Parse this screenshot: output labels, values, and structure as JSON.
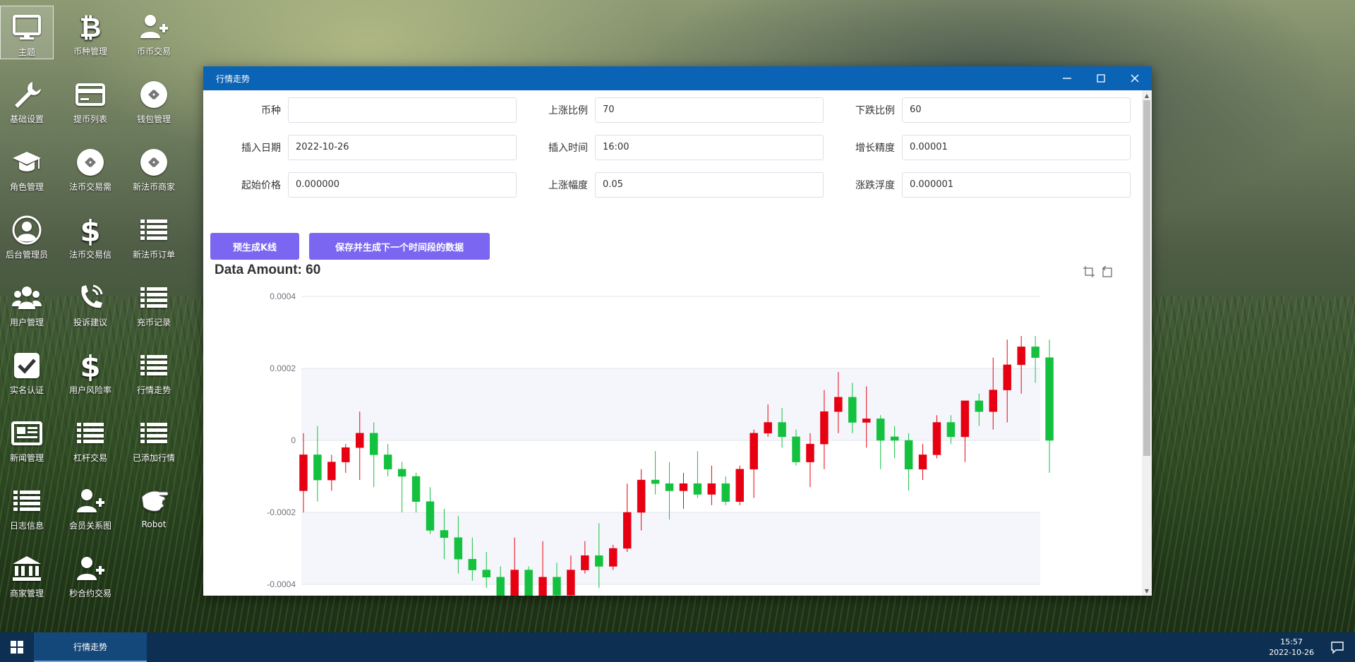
{
  "desktop": {
    "icons": [
      {
        "label": "主题",
        "icon": "monitor-icon"
      },
      {
        "label": "币种管理",
        "icon": "bitcoin-icon"
      },
      {
        "label": "币币交易",
        "icon": "user-plus-icon"
      },
      {
        "label": "基础设置",
        "icon": "wrench-icon"
      },
      {
        "label": "提币列表",
        "icon": "credit-card-icon"
      },
      {
        "label": "钱包管理",
        "icon": "exchange-icon"
      },
      {
        "label": "角色管理",
        "icon": "graduation-cap-icon"
      },
      {
        "label": "法币交易需",
        "icon": "exchange-icon"
      },
      {
        "label": "新法币商家",
        "icon": "exchange-icon"
      },
      {
        "label": "后台管理员",
        "icon": "user-circle-icon"
      },
      {
        "label": "法币交易信",
        "icon": "dollar-icon"
      },
      {
        "label": "新法币订单",
        "icon": "list-icon"
      },
      {
        "label": "用户管理",
        "icon": "users-icon"
      },
      {
        "label": "投诉建议",
        "icon": "phone-icon"
      },
      {
        "label": "充币记录",
        "icon": "list-icon"
      },
      {
        "label": "实名认证",
        "icon": "check-square-icon"
      },
      {
        "label": "用户风险率",
        "icon": "dollar-icon"
      },
      {
        "label": "行情走势",
        "icon": "list-icon"
      },
      {
        "label": "新闻管理",
        "icon": "newspaper-icon"
      },
      {
        "label": "杠杆交易",
        "icon": "list-icon"
      },
      {
        "label": "已添加行情",
        "icon": "list-icon"
      },
      {
        "label": "日志信息",
        "icon": "list-icon"
      },
      {
        "label": "会员关系图",
        "icon": "user-plus-icon"
      },
      {
        "label": "Robot",
        "icon": "hand-icon"
      },
      {
        "label": "商家管理",
        "icon": "bank-icon"
      },
      {
        "label": "秒合约交易",
        "icon": "user-plus-icon"
      }
    ]
  },
  "window": {
    "title": "行情走势",
    "form": {
      "coin": {
        "label": "币种",
        "value": ""
      },
      "rise_ratio": {
        "label": "上涨比例",
        "value": "70"
      },
      "fall_ratio": {
        "label": "下跌比例",
        "value": "60"
      },
      "insert_date": {
        "label": "插入日期",
        "value": "2022-10-26"
      },
      "insert_time": {
        "label": "插入时间",
        "value": "16:00"
      },
      "growth_precision": {
        "label": "增长精度",
        "value": "0.00001"
      },
      "start_price": {
        "label": "起始价格",
        "value": "0.000000"
      },
      "rise_range": {
        "label": "上涨幅度",
        "value": "0.05"
      },
      "fluctuation": {
        "label": "涨跌浮度",
        "value": "0.000001"
      }
    },
    "buttons": {
      "pregenerate": "预生成K线",
      "save_next": "保存并生成下一个时间段的数据"
    },
    "data_amount": "Data Amount: 60"
  },
  "colors": {
    "up": "#e60012",
    "down": "#14c13f",
    "accent": "#7b66f2",
    "titlebar": "#0b63b6",
    "taskbar": "#0c2f52"
  },
  "chart_data": {
    "type": "candlestick",
    "y_tick_labels": [
      "0.0004",
      "0.0002",
      "0",
      "-0.0002",
      "-0.0004"
    ],
    "y_ticks": [
      0.0004,
      0.0002,
      0,
      -0.0002,
      -0.0004
    ],
    "ylim": [
      -0.00048,
      0.0004
    ],
    "grid": true,
    "candles": [
      {
        "o": -0.00014,
        "c": -4e-05,
        "h": 2e-05,
        "l": -0.0002
      },
      {
        "o": -4e-05,
        "c": -0.00011,
        "h": 4e-05,
        "l": -0.00017
      },
      {
        "o": -0.00011,
        "c": -6e-05,
        "h": -4e-05,
        "l": -0.00014
      },
      {
        "o": -6e-05,
        "c": -2e-05,
        "h": -1e-05,
        "l": -9e-05
      },
      {
        "o": -2e-05,
        "c": 2e-05,
        "h": 8e-05,
        "l": -0.00011
      },
      {
        "o": 2e-05,
        "c": -4e-05,
        "h": 5e-05,
        "l": -0.00013
      },
      {
        "o": -4e-05,
        "c": -8e-05,
        "h": -1e-05,
        "l": -0.0001
      },
      {
        "o": -8e-05,
        "c": -0.0001,
        "h": -6e-05,
        "l": -0.0002
      },
      {
        "o": -0.0001,
        "c": -0.00017,
        "h": -9e-05,
        "l": -0.0002
      },
      {
        "o": -0.00017,
        "c": -0.00025,
        "h": -0.00013,
        "l": -0.00026
      },
      {
        "o": -0.00025,
        "c": -0.00027,
        "h": -0.00019,
        "l": -0.00033
      },
      {
        "o": -0.00027,
        "c": -0.00033,
        "h": -0.00021,
        "l": -0.00037
      },
      {
        "o": -0.00033,
        "c": -0.00036,
        "h": -0.00027,
        "l": -0.00039
      },
      {
        "o": -0.00036,
        "c": -0.00038,
        "h": -0.00031,
        "l": -0.00041
      },
      {
        "o": -0.00038,
        "c": -0.00046,
        "h": -0.00035,
        "l": -0.00048
      },
      {
        "o": -0.00046,
        "c": -0.00036,
        "h": -0.00027,
        "l": -0.00048
      },
      {
        "o": -0.00036,
        "c": -0.00044,
        "h": -0.00035,
        "l": -0.00048
      },
      {
        "o": -0.00044,
        "c": -0.00038,
        "h": -0.00028,
        "l": -0.00047
      },
      {
        "o": -0.00038,
        "c": -0.00043,
        "h": -0.00034,
        "l": -0.00045
      },
      {
        "o": -0.00043,
        "c": -0.00036,
        "h": -0.00032,
        "l": -0.00044
      },
      {
        "o": -0.00036,
        "c": -0.00032,
        "h": -0.00028,
        "l": -0.00037
      },
      {
        "o": -0.00032,
        "c": -0.00035,
        "h": -0.00023,
        "l": -0.00041
      },
      {
        "o": -0.00035,
        "c": -0.0003,
        "h": -0.00029,
        "l": -0.00036
      },
      {
        "o": -0.0003,
        "c": -0.0002,
        "h": -0.00012,
        "l": -0.00031
      },
      {
        "o": -0.0002,
        "c": -0.00011,
        "h": -8e-05,
        "l": -0.00025
      },
      {
        "o": -0.00011,
        "c": -0.00012,
        "h": -3e-05,
        "l": -0.00015
      },
      {
        "o": -0.00012,
        "c": -0.00014,
        "h": -6e-05,
        "l": -0.00022
      },
      {
        "o": -0.00014,
        "c": -0.00012,
        "h": -9e-05,
        "l": -0.00019
      },
      {
        "o": -0.00012,
        "c": -0.00015,
        "h": -3e-05,
        "l": -0.00016
      },
      {
        "o": -0.00015,
        "c": -0.00012,
        "h": -7e-05,
        "l": -0.00018
      },
      {
        "o": -0.00012,
        "c": -0.00017,
        "h": -0.0001,
        "l": -0.00018
      },
      {
        "o": -0.00017,
        "c": -8e-05,
        "h": -7e-05,
        "l": -0.00018
      },
      {
        "o": -8e-05,
        "c": 2e-05,
        "h": 3e-05,
        "l": -0.00016
      },
      {
        "o": 2e-05,
        "c": 5e-05,
        "h": 0.0001,
        "l": 1e-05
      },
      {
        "o": 5e-05,
        "c": 1e-05,
        "h": 9e-05,
        "l": -2e-05
      },
      {
        "o": 1e-05,
        "c": -6e-05,
        "h": 3e-05,
        "l": -7e-05
      },
      {
        "o": -6e-05,
        "c": -1e-05,
        "h": 2e-05,
        "l": -0.00013
      },
      {
        "o": -1e-05,
        "c": 8e-05,
        "h": 0.00014,
        "l": -8e-05
      },
      {
        "o": 8e-05,
        "c": 0.00012,
        "h": 0.00019,
        "l": 2e-05
      },
      {
        "o": 0.00012,
        "c": 5e-05,
        "h": 0.00016,
        "l": 2e-05
      },
      {
        "o": 5e-05,
        "c": 6e-05,
        "h": 0.00015,
        "l": -2e-05
      },
      {
        "o": 6e-05,
        "c": 0,
        "h": 7e-05,
        "l": -8e-05
      },
      {
        "o": 1e-05,
        "c": 0,
        "h": 4e-05,
        "l": -5e-05
      },
      {
        "o": 0,
        "c": -8e-05,
        "h": 2e-05,
        "l": -0.00014
      },
      {
        "o": -8e-05,
        "c": -4e-05,
        "h": -1e-05,
        "l": -0.00011
      },
      {
        "o": -4e-05,
        "c": 5e-05,
        "h": 7e-05,
        "l": -5e-05
      },
      {
        "o": 5e-05,
        "c": 1e-05,
        "h": 7e-05,
        "l": -1e-05
      },
      {
        "o": 1e-05,
        "c": 0.00011,
        "h": 0.00011,
        "l": -6e-05
      },
      {
        "o": 0.00011,
        "c": 8e-05,
        "h": 0.00013,
        "l": 4e-05
      },
      {
        "o": 8e-05,
        "c": 0.00014,
        "h": 0.00023,
        "l": 3e-05
      },
      {
        "o": 0.00014,
        "c": 0.00021,
        "h": 0.00028,
        "l": 5e-05
      },
      {
        "o": 0.00021,
        "c": 0.00026,
        "h": 0.00029,
        "l": 0.00013
      },
      {
        "o": 0.00026,
        "c": 0.00023,
        "h": 0.00029,
        "l": 0.00016
      },
      {
        "o": 0.00023,
        "c": 0,
        "h": 0.00028,
        "l": -9e-05
      }
    ]
  },
  "taskbar": {
    "active_item": "行情走势",
    "time": "15:57",
    "date": "2022-10-26"
  }
}
